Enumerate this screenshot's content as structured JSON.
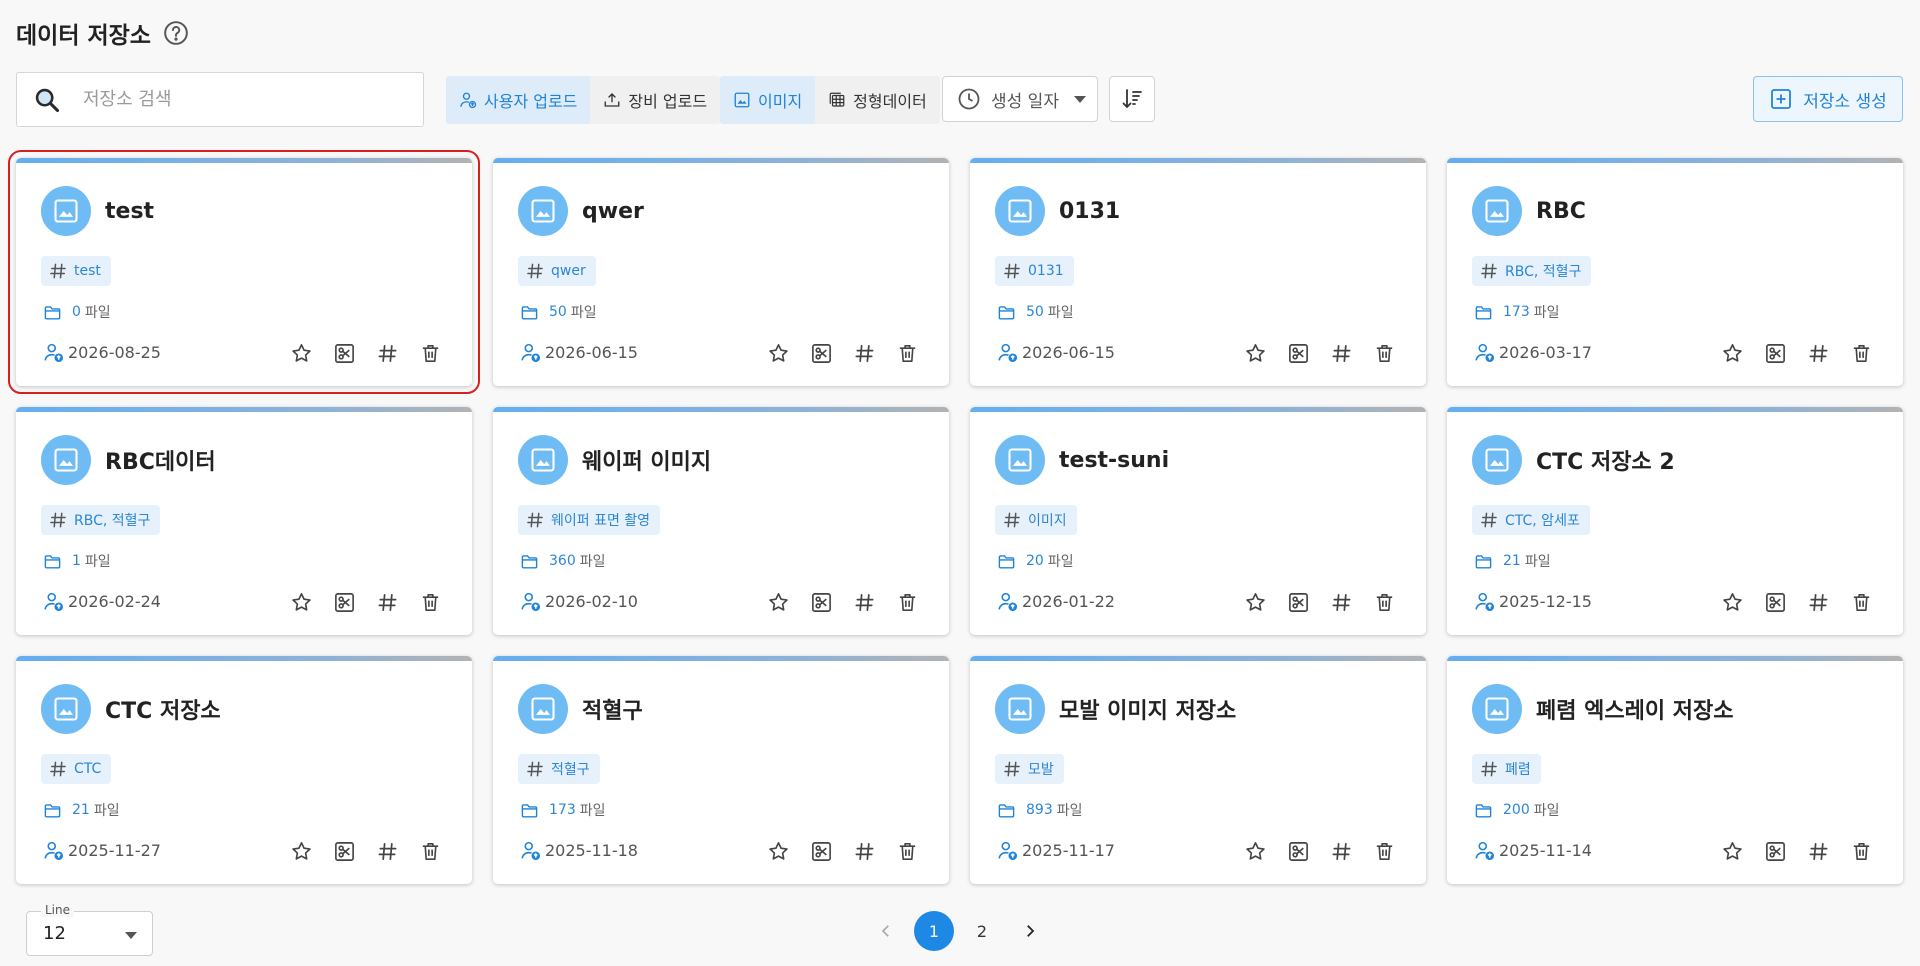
{
  "header": {
    "title": "데이터 저장소",
    "help_icon": "help-circle-icon"
  },
  "search": {
    "placeholder": "저장소 검색",
    "value": ""
  },
  "upload_filter": [
    {
      "label": "사용자 업로드",
      "active": true
    },
    {
      "label": "장비 업로드",
      "active": false
    }
  ],
  "type_filter": [
    {
      "label": "이미지",
      "active": true
    },
    {
      "label": "정형데이터",
      "active": false
    }
  ],
  "sort": {
    "label": "생성 일자"
  },
  "create_button": {
    "label": "저장소 생성"
  },
  "cards": [
    {
      "title": "test",
      "tag": "test",
      "file_count": "0",
      "file_unit": "파일",
      "date": "2026-08-25",
      "selected": true
    },
    {
      "title": "qwer",
      "tag": "qwer",
      "file_count": "50",
      "file_unit": "파일",
      "date": "2026-06-15"
    },
    {
      "title": "0131",
      "tag": "0131",
      "file_count": "50",
      "file_unit": "파일",
      "date": "2026-06-15"
    },
    {
      "title": "RBC",
      "tag": "RBC, 적혈구",
      "file_count": "173",
      "file_unit": "파일",
      "date": "2026-03-17"
    },
    {
      "title": "RBC데이터",
      "tag": "RBC, 적혈구",
      "file_count": "1",
      "file_unit": "파일",
      "date": "2026-02-24"
    },
    {
      "title": "웨이퍼 이미지",
      "tag": "웨이퍼 표면 촬영",
      "file_count": "360",
      "file_unit": "파일",
      "date": "2026-02-10"
    },
    {
      "title": "test-suni",
      "tag": "이미지",
      "file_count": "20",
      "file_unit": "파일",
      "date": "2026-01-22"
    },
    {
      "title": "CTC 저장소 2",
      "tag": "CTC, 암세포",
      "file_count": "21",
      "file_unit": "파일",
      "date": "2025-12-15"
    },
    {
      "title": "CTC 저장소",
      "tag": "CTC",
      "file_count": "21",
      "file_unit": "파일",
      "date": "2025-11-27"
    },
    {
      "title": "적혈구",
      "tag": "적혈구",
      "file_count": "173",
      "file_unit": "파일",
      "date": "2025-11-18"
    },
    {
      "title": "모발 이미지 저장소",
      "tag": "모발",
      "file_count": "893",
      "file_unit": "파일",
      "date": "2025-11-17"
    },
    {
      "title": "폐렴 엑스레이 저장소",
      "tag": "폐렴",
      "file_count": "200",
      "file_unit": "파일",
      "date": "2025-11-14"
    }
  ],
  "line_select": {
    "label": "Line",
    "value": "12"
  },
  "pagination": {
    "pages": [
      "1",
      "2"
    ],
    "current": "1"
  },
  "colors": {
    "accent": "#1e88e5",
    "avatar": "#6fbcf4",
    "tag_bg": "#e6f1fb",
    "selection": "#d62020"
  }
}
